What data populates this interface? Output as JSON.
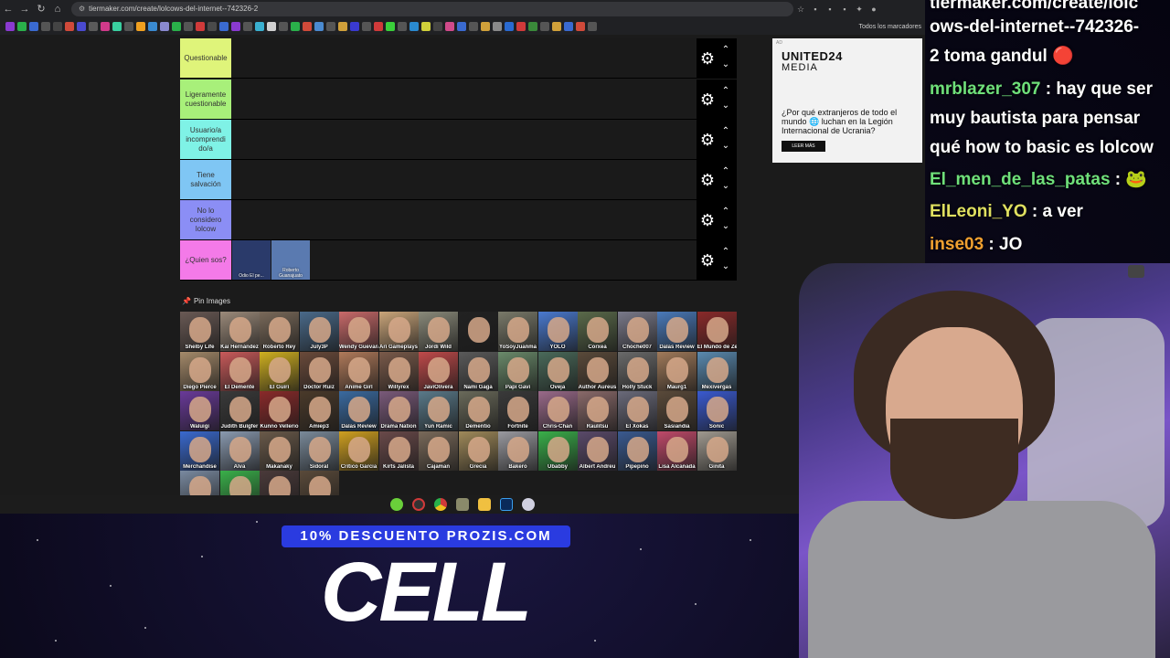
{
  "browser": {
    "url": "tiermaker.com/create/lolcows-del-internet--742326-2",
    "bookmarks_all": "Todos los marcadores"
  },
  "tiers": [
    {
      "label": "Questionable",
      "color": "#dff47a"
    },
    {
      "label": "Ligeramente cuestionable",
      "color": "#a8f07a"
    },
    {
      "label": "Usuario/a incomprendi do/a",
      "color": "#7ff2e6"
    },
    {
      "label": "Tiene salvación",
      "color": "#7fc6f4"
    },
    {
      "label": "No lo considero lolcow",
      "color": "#8b8ef5"
    },
    {
      "label": "¿Quien sos?",
      "color": "#f47ae8",
      "items": [
        "Odio El pe...",
        "Roberto Guanajuato"
      ]
    }
  ],
  "pin": {
    "label": "Pin Images"
  },
  "grid_items": [
    {
      "name": "Shelby Life",
      "color": "#6a5a55"
    },
    {
      "name": "Kai Hernández",
      "color": "#9b8a7a"
    },
    {
      "name": "Roberto Rey",
      "color": "#7a6a5a"
    },
    {
      "name": "July3P",
      "color": "#4a6a8a"
    },
    {
      "name": "Wendy Guevara",
      "color": "#c96a6a"
    },
    {
      "name": "Ari Gameplays",
      "color": "#caa57a"
    },
    {
      "name": "Jordi Wild",
      "color": "#8a8a7a"
    },
    {
      "name": "",
      "color": "#222222"
    },
    {
      "name": "YoSoyJuanma",
      "color": "#7a7a6a"
    },
    {
      "name": "YOLO",
      "color": "#4a7ad0"
    },
    {
      "name": "Corxea",
      "color": "#5a6a4a"
    },
    {
      "name": "Choche007",
      "color": "#7a7a8a"
    },
    {
      "name": "Dalas Review",
      "color": "#4a7aba"
    },
    {
      "name": "El Mundo de Zeta",
      "color": "#8a2a2a"
    },
    {
      "name": "Diego Pierce",
      "color": "#a58a6a"
    },
    {
      "name": "El Demente",
      "color": "#c95a5a"
    },
    {
      "name": "El Guiri",
      "color": "#d0b020"
    },
    {
      "name": "Doctor Ruiz",
      "color": "#6a4a3a"
    },
    {
      "name": "Anime Girl",
      "color": "#b07a5a"
    },
    {
      "name": "Willyrex",
      "color": "#7a5a4a"
    },
    {
      "name": "JaviOlivera",
      "color": "#c04a4a"
    },
    {
      "name": "Nami Gaga",
      "color": "#5a5a5a"
    },
    {
      "name": "Papi Gavi",
      "color": "#6a8a6a"
    },
    {
      "name": "Oveja",
      "color": "#4a6a5a"
    },
    {
      "name": "Author Aureus",
      "color": "#5a4a3a"
    },
    {
      "name": "Holly Stuck",
      "color": "#6a6a6a"
    },
    {
      "name": "Maurg1",
      "color": "#a07a5a"
    },
    {
      "name": "Mexivergas",
      "color": "#5a8ab0"
    },
    {
      "name": "Waluigi",
      "color": "#6a3a9a"
    },
    {
      "name": "Judith Bulgfer",
      "color": "#3a3a3a"
    },
    {
      "name": "Kunno Vellerio",
      "color": "#8a2a2a"
    },
    {
      "name": "Amiep3",
      "color": "#4a3a2a"
    },
    {
      "name": "Dalas Review",
      "color": "#3a6aa0"
    },
    {
      "name": "Drama Nation",
      "color": "#7a5a7a"
    },
    {
      "name": "Yun Ramic",
      "color": "#5a7a8a"
    },
    {
      "name": "Dementio",
      "color": "#6a6a5a"
    },
    {
      "name": "Fortnite",
      "color": "#3a3a3a"
    },
    {
      "name": "Chris-Chan",
      "color": "#9a6a8a"
    },
    {
      "name": "Raulitsu",
      "color": "#8a6a6a"
    },
    {
      "name": "El Xokas",
      "color": "#6a6a7a"
    },
    {
      "name": "Sasiandia",
      "color": "#5a4a3a"
    },
    {
      "name": "Sonic",
      "color": "#3a5ad0"
    },
    {
      "name": "Merchandise",
      "color": "#3a6ad0"
    },
    {
      "name": "Alva",
      "color": "#8a9ab0"
    },
    {
      "name": "Makanaky",
      "color": "#6a5a4a"
    },
    {
      "name": "Sidoral",
      "color": "#7a8a9a"
    },
    {
      "name": "Critico Garcia",
      "color": "#d0a020"
    },
    {
      "name": "Kirts Jalista",
      "color": "#6a4a4a"
    },
    {
      "name": "Cajaman",
      "color": "#7a6a5a"
    },
    {
      "name": "Grecia",
      "color": "#a08a5a"
    },
    {
      "name": "Bakero",
      "color": "#9a9aa0"
    },
    {
      "name": "Ubabby",
      "color": "#3ab04a"
    },
    {
      "name": "Albert Andreu",
      "color": "#5a4a6a"
    },
    {
      "name": "Pipepino",
      "color": "#3a5a90"
    },
    {
      "name": "Lisa Alcanada",
      "color": "#c04a6a"
    },
    {
      "name": "Ginita",
      "color": "#a09a90"
    },
    {
      "name": "",
      "color": "#7a8aa0"
    },
    {
      "name": "",
      "color": "#3ab04a"
    },
    {
      "name": "",
      "color": "#4a3a3a"
    },
    {
      "name": "",
      "color": "#5a4a3a"
    }
  ],
  "ad": {
    "tag": "AD",
    "brand_line1": "UNITED24",
    "brand_line2": "MEDIA",
    "text": "¿Por qué extranjeros de todo el mundo 🌐 luchan en la Legión Internacional de Ucrania?",
    "button": "LEER MÁS"
  },
  "chat": [
    {
      "user": "",
      "text": "tiermaker.com/create/lolc"
    },
    {
      "user": "",
      "text": "ows-del-internet--742326-"
    },
    {
      "user": "",
      "text": "2 toma gandul 🔴"
    },
    {
      "user": "mrblazer_307",
      "user_color": "#6fe07a",
      "text": " : hay que ser"
    },
    {
      "user": "",
      "text": "muy bautista para pensar"
    },
    {
      "user": "",
      "text": "qué how to basic es lolcow"
    },
    {
      "user": "El_men_de_las_patas",
      "user_color": "#6fe07a",
      "text": " : 🐸"
    },
    {
      "user": "ElLeoni_YO",
      "user_color": "#e0e060",
      "text": " : a ver"
    },
    {
      "user": "inse03",
      "user_color": "#f0a030",
      "text": " : JO"
    }
  ],
  "promo": {
    "banner": "10% DESCUENTO PROZIS.COM",
    "big": "CELL"
  }
}
